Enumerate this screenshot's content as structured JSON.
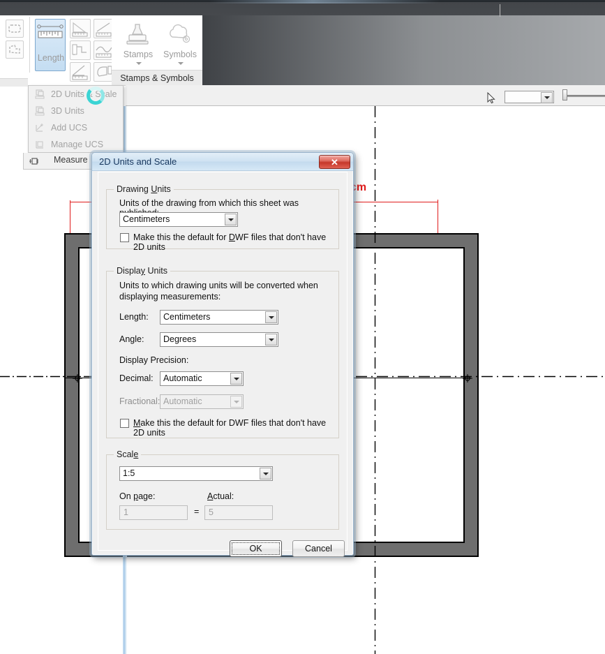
{
  "app": {
    "titlebar_color": "#45484c",
    "ribbon": {
      "measure_panel": {
        "big_button_label": "Length",
        "big_button_icon": "measure-length-icon",
        "tools": [
          {
            "name": "measure-distance-icon"
          },
          {
            "name": "measure-line-icon"
          },
          {
            "name": "measure-polyline-icon"
          },
          {
            "name": "measure-curve-icon"
          },
          {
            "name": "measure-angle-icon"
          },
          {
            "name": "measure-volume-icon"
          }
        ],
        "shape_tools": [
          {
            "name": "shape-rectangle-icon"
          },
          {
            "name": "shape-polygon-icon"
          }
        ]
      },
      "stamps_panel": {
        "title": "Stamps & Symbols",
        "buttons": [
          {
            "label": "Stamps",
            "icon": "stamp-icon"
          },
          {
            "label": "Symbols",
            "icon": "symbols-cloud-icon"
          }
        ]
      }
    },
    "menu": {
      "items": [
        {
          "label": "2D Units & Scale",
          "icon": "units-2d-icon",
          "disabled": true
        },
        {
          "label": "3D Units",
          "icon": "units-3d-icon",
          "disabled": true
        },
        {
          "label": "Add UCS",
          "icon": "add-ucs-icon",
          "disabled": true
        },
        {
          "label": "Manage UCS",
          "icon": "manage-ucs-icon",
          "disabled": true
        }
      ],
      "footer_item": {
        "label": "Measure",
        "icon": "measure-pin-icon"
      },
      "spinner": {
        "name": "loading-spinner",
        "color": "#3bd4d4"
      }
    },
    "toolbar": {
      "combo_value": "",
      "cursor": "mouse-pointer",
      "zoom_slider_position": "left"
    },
    "canvas": {
      "unit_label": "cm",
      "unit_label_color": "#e01b1b"
    }
  },
  "dialog": {
    "title": "2D Units and Scale",
    "close_label": "✕",
    "drawing_units": {
      "legend": "Drawing Units",
      "description": "Units of the drawing from which this sheet was published:",
      "units_value": "Centimeters",
      "checkbox_label_pre": "Make this the default for ",
      "checkbox_label_underline": "D",
      "checkbox_label_post": "WF files that don't have 2D units",
      "checkbox_checked": false
    },
    "display_units": {
      "legend": "Display Units",
      "description": "Units to which drawing units will be converted when displaying measurements:",
      "length_label": "Length:",
      "length_value": "Centimeters",
      "angle_label": "Angle:",
      "angle_value": "Degrees",
      "precision_label": "Display Precision:",
      "decimal_label": "Decimal:",
      "decimal_value": "Automatic",
      "fractional_label": "Fractional:",
      "fractional_value": "Automatic",
      "fractional_disabled": true,
      "checkbox_label_pre": "",
      "checkbox_label_underline": "M",
      "checkbox_label_post": "ake this the default for DWF files that don't have 2D units",
      "checkbox_checked": false
    },
    "scale": {
      "legend": "Scale",
      "value": "1:5",
      "on_page_label_pre": "On ",
      "on_page_label_underline": "p",
      "on_page_label_post": "age:",
      "actual_label_underline": "A",
      "actual_label_post": "ctual:",
      "on_page_value": "1",
      "equals": "=",
      "actual_value": "5",
      "fields_disabled": true
    },
    "buttons": {
      "ok": "OK",
      "cancel": "Cancel"
    }
  }
}
